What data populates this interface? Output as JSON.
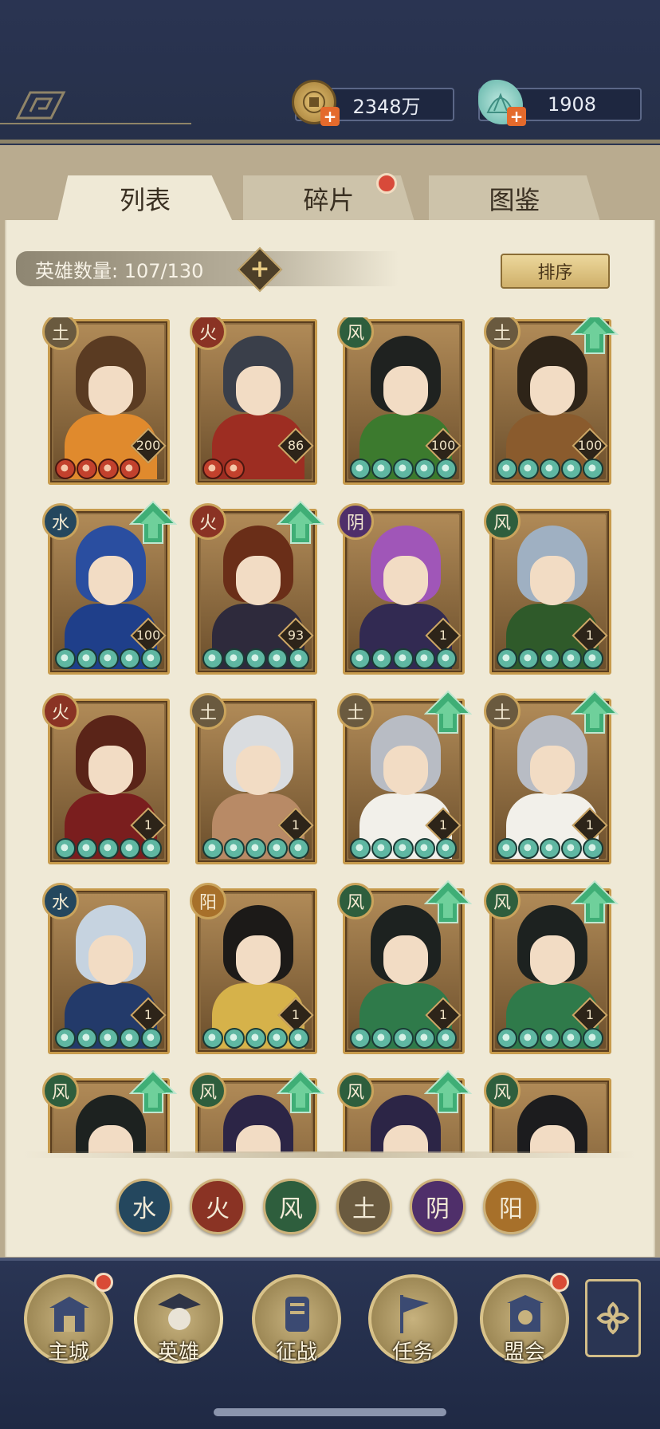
{
  "currency": {
    "coins": "2348万",
    "jade": "1908",
    "coin_icon": "coin-icon",
    "jade_icon": "jade-shell-icon"
  },
  "tabs": [
    {
      "label": "列表",
      "active": true
    },
    {
      "label": "碎片",
      "active": false,
      "notification": true
    },
    {
      "label": "图鉴",
      "active": false
    }
  ],
  "hero_count": {
    "label": "英雄数量: 107/130"
  },
  "sort_label": "排序",
  "element_glyphs": {
    "earth": "土",
    "fire": "火",
    "wind": "风",
    "water": "水",
    "yin": "阴",
    "yang": "阳"
  },
  "heroes": [
    {
      "element": "earth",
      "glyph": "土",
      "level": "200",
      "stars": 4,
      "star_color": "red",
      "upgrade": false,
      "hair": "#5a3b22",
      "outfit": "#e08a2d"
    },
    {
      "element": "fire",
      "glyph": "火",
      "level": "86",
      "stars": 2,
      "star_color": "red",
      "upgrade": false,
      "hair": "#3a3f4a",
      "outfit": "#9d2d22"
    },
    {
      "element": "wind",
      "glyph": "风",
      "level": "100",
      "stars": 5,
      "star_color": "green",
      "upgrade": false,
      "hair": "#1f2220",
      "outfit": "#3c7a2e"
    },
    {
      "element": "earth",
      "glyph": "土",
      "level": "100",
      "stars": 5,
      "star_color": "green",
      "upgrade": true,
      "hair": "#2e2418",
      "outfit": "#8a5b2d"
    },
    {
      "element": "water",
      "glyph": "水",
      "level": "100",
      "stars": 5,
      "star_color": "green",
      "upgrade": true,
      "hair": "#2a4ea0",
      "outfit": "#1f3f8a"
    },
    {
      "element": "fire",
      "glyph": "火",
      "level": "93",
      "stars": 5,
      "star_color": "green",
      "upgrade": true,
      "hair": "#6a2e18",
      "outfit": "#2e2a3c"
    },
    {
      "element": "yin",
      "glyph": "阴",
      "level": "1",
      "stars": 5,
      "star_color": "green",
      "upgrade": false,
      "hair": "#a056b8",
      "outfit": "#322a52"
    },
    {
      "element": "wind",
      "glyph": "风",
      "level": "1",
      "stars": 5,
      "star_color": "green",
      "upgrade": false,
      "hair": "#9fb0c2",
      "outfit": "#2f5a2a"
    },
    {
      "element": "fire",
      "glyph": "火",
      "level": "1",
      "stars": 5,
      "star_color": "green",
      "upgrade": false,
      "hair": "#5a2418",
      "outfit": "#7a1e1e"
    },
    {
      "element": "earth",
      "glyph": "土",
      "level": "1",
      "stars": 5,
      "star_color": "green",
      "upgrade": false,
      "hair": "#d9dcdf",
      "outfit": "#b88a66"
    },
    {
      "element": "earth",
      "glyph": "土",
      "level": "1",
      "stars": 5,
      "star_color": "green",
      "upgrade": true,
      "hair": "#b8bcc4",
      "outfit": "#f2f0ea"
    },
    {
      "element": "earth",
      "glyph": "土",
      "level": "1",
      "stars": 5,
      "star_color": "green",
      "upgrade": true,
      "hair": "#b8bcc4",
      "outfit": "#f2f0ea"
    },
    {
      "element": "water",
      "glyph": "水",
      "level": "1",
      "stars": 5,
      "star_color": "green",
      "upgrade": false,
      "hair": "#c6d3e0",
      "outfit": "#233a6a"
    },
    {
      "element": "yang",
      "glyph": "阳",
      "level": "1",
      "stars": 5,
      "star_color": "green",
      "upgrade": false,
      "hair": "#1c1a18",
      "outfit": "#d6b24a"
    },
    {
      "element": "wind",
      "glyph": "风",
      "level": "1",
      "stars": 5,
      "star_color": "green",
      "upgrade": true,
      "hair": "#1d2220",
      "outfit": "#2f7a4a"
    },
    {
      "element": "wind",
      "glyph": "风",
      "level": "1",
      "stars": 5,
      "star_color": "green",
      "upgrade": true,
      "hair": "#1d2220",
      "outfit": "#2f7a4a"
    },
    {
      "element": "wind",
      "glyph": "风",
      "level": "",
      "stars": 0,
      "star_color": "green",
      "upgrade": true,
      "hair": "#1d2220",
      "outfit": "#2f7a4a"
    },
    {
      "element": "wind",
      "glyph": "风",
      "level": "",
      "stars": 0,
      "star_color": "green",
      "upgrade": true,
      "hair": "#2c2546",
      "outfit": "#3b3360"
    },
    {
      "element": "wind",
      "glyph": "风",
      "level": "",
      "stars": 0,
      "star_color": "green",
      "upgrade": true,
      "hair": "#2c2546",
      "outfit": "#3b3360"
    },
    {
      "element": "wind",
      "glyph": "风",
      "level": "",
      "stars": 0,
      "star_color": "green",
      "upgrade": false,
      "hair": "#1c1c1e",
      "outfit": "#2a2a30"
    }
  ],
  "filters": [
    {
      "element": "water",
      "glyph": "水"
    },
    {
      "element": "fire",
      "glyph": "火"
    },
    {
      "element": "wind",
      "glyph": "风"
    },
    {
      "element": "earth",
      "glyph": "土"
    },
    {
      "element": "yin",
      "glyph": "阴"
    },
    {
      "element": "yang",
      "glyph": "阳"
    }
  ],
  "nav": [
    {
      "label": "主城",
      "icon": "city-gate-icon",
      "notification": true,
      "active": false
    },
    {
      "label": "英雄",
      "icon": "hero-portrait-icon",
      "notification": false,
      "active": true
    },
    {
      "label": "征战",
      "icon": "battle-scroll-icon",
      "notification": false,
      "active": false
    },
    {
      "label": "任务",
      "icon": "task-flag-icon",
      "notification": false,
      "active": false
    },
    {
      "label": "盟会",
      "icon": "guild-hall-icon",
      "notification": true,
      "active": false
    }
  ],
  "nav_extra_icon": "menu-flower-icon",
  "colors": {
    "navy": "#2a3452",
    "paper": "#efe9d6",
    "gold_border": "#c79b4d",
    "notification_red": "#d84a3a",
    "upgrade_green": "#3fae76"
  }
}
